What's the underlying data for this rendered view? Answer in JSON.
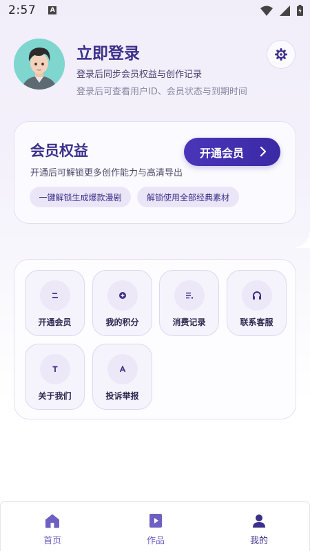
{
  "status_bar": {
    "time": "2:57",
    "notification_badge": "A"
  },
  "profile": {
    "title": "立即登录",
    "subtitle": "登录后同步会员权益与创作记录",
    "hint": "登录后可查看用户ID、会员状态与到期时间"
  },
  "member_card": {
    "title": "会员权益",
    "description": "开通后可解锁更多创作能力与高清导出",
    "open_button": "开通会员",
    "benefits": [
      "一键解锁生成爆款漫剧",
      "解锁使用全部经典素材"
    ]
  },
  "grid": {
    "items": [
      {
        "label": "开通会员",
        "icon": "member-icon"
      },
      {
        "label": "我的积分",
        "icon": "points-icon"
      },
      {
        "label": "消费记录",
        "icon": "records-icon"
      },
      {
        "label": "联系客服",
        "icon": "headset-icon"
      },
      {
        "label": "关于我们",
        "icon": "about-icon"
      },
      {
        "label": "投诉举报",
        "icon": "report-icon"
      }
    ]
  },
  "bottom_nav": {
    "items": [
      {
        "label": "首页",
        "icon": "home-icon"
      },
      {
        "label": "作品",
        "icon": "works-icon"
      },
      {
        "label": "我的",
        "icon": "profile-icon",
        "active": true
      }
    ]
  },
  "colors": {
    "accent": "#3b2f8a",
    "button": "#4a35b8",
    "pill_bg": "#ebe6f7",
    "nav_inactive": "#6e5fc2"
  }
}
